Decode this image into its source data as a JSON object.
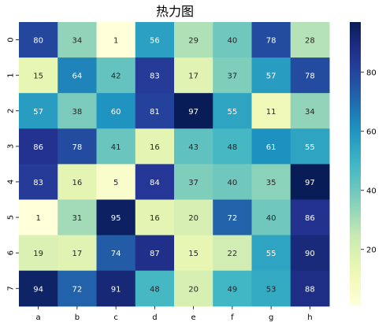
{
  "chart_data": {
    "type": "heatmap",
    "title": "热力图",
    "xlabel": "",
    "ylabel": "",
    "columns": [
      "a",
      "b",
      "c",
      "d",
      "e",
      "f",
      "g",
      "h"
    ],
    "rows": [
      "0",
      "1",
      "2",
      "3",
      "4",
      "5",
      "6",
      "7"
    ],
    "values": [
      [
        80,
        34,
        1,
        56,
        29,
        40,
        78,
        28
      ],
      [
        15,
        64,
        42,
        83,
        17,
        37,
        57,
        78
      ],
      [
        57,
        38,
        60,
        81,
        97,
        55,
        11,
        34
      ],
      [
        86,
        78,
        41,
        16,
        43,
        48,
        61,
        55
      ],
      [
        83,
        16,
        5,
        84,
        37,
        40,
        35,
        97
      ],
      [
        1,
        31,
        95,
        16,
        20,
        72,
        40,
        86
      ],
      [
        19,
        17,
        74,
        87,
        15,
        22,
        55,
        90
      ],
      [
        94,
        72,
        91,
        48,
        20,
        49,
        53,
        88
      ]
    ],
    "colorbar": {
      "colormap": "YlGnBu",
      "range": [
        1,
        97
      ],
      "ticks": [
        20,
        40,
        60,
        80
      ]
    },
    "annotations": true,
    "grid": false
  }
}
